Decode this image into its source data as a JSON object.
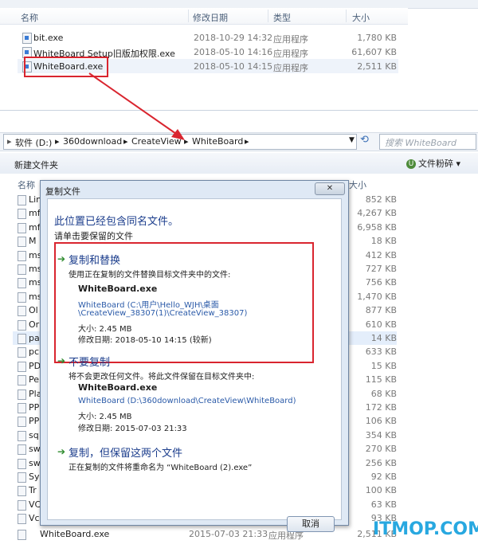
{
  "top_explorer": {
    "columns": {
      "name": "名称",
      "date": "修改日期",
      "type": "类型",
      "size": "大小"
    },
    "files": [
      {
        "name": "bit.exe",
        "date": "2018-10-29 14:32",
        "type": "应用程序",
        "size": "1,780 KB"
      },
      {
        "name": "WhiteBoard Setup旧版加权限.exe",
        "date": "2018-05-10 14:16",
        "type": "应用程序",
        "size": "61,607 KB"
      },
      {
        "name": "WhiteBoard.exe",
        "date": "2018-05-10 14:15",
        "type": "应用程序",
        "size": "2,511 KB"
      }
    ]
  },
  "address_bar": {
    "crumbs": [
      "软件 (D:)",
      "360download",
      "CreateView",
      "WhiteBoard"
    ],
    "search_placeholder": "搜索 WhiteBoard"
  },
  "toolbar": {
    "new_folder": "新建文件夹",
    "shredder": "文件粉碎"
  },
  "bg_list": {
    "header_name": "名称",
    "header_size": "大小",
    "rows": [
      {
        "name": "Lin",
        "size": "852 KB"
      },
      {
        "name": "mf",
        "size": "4,267 KB"
      },
      {
        "name": "mf",
        "size": "6,958 KB"
      },
      {
        "name": "M",
        "size": "18 KB"
      },
      {
        "name": "ms",
        "size": "412 KB"
      },
      {
        "name": "ms",
        "size": "727 KB"
      },
      {
        "name": "ms",
        "size": "756 KB"
      },
      {
        "name": "ms",
        "size": "1,470 KB"
      },
      {
        "name": "Ol",
        "size": "877 KB"
      },
      {
        "name": "Or",
        "size": "610 KB"
      },
      {
        "name": "pa",
        "size": "14 KB"
      },
      {
        "name": "pc",
        "size": "633 KB"
      },
      {
        "name": "PD",
        "size": "15 KB"
      },
      {
        "name": "Pe",
        "size": "115 KB"
      },
      {
        "name": "Pla",
        "size": "68 KB"
      },
      {
        "name": "PP",
        "size": "172 KB"
      },
      {
        "name": "PP",
        "size": "106 KB"
      },
      {
        "name": "sq",
        "size": "354 KB"
      },
      {
        "name": "sw",
        "size": "270 KB"
      },
      {
        "name": "sw",
        "size": "256 KB"
      },
      {
        "name": "Sy",
        "size": "92 KB"
      },
      {
        "name": "Tr",
        "size": "100 KB"
      },
      {
        "name": "VC",
        "size": "63 KB"
      },
      {
        "name": "Vc",
        "size": "93 KB"
      }
    ],
    "last_row": {
      "name": "WhiteBoard.exe",
      "date": "2015-07-03 21:33",
      "type": "应用程序",
      "size": "2,511 KB"
    }
  },
  "dialog": {
    "title": "复制文件",
    "heading": "此位置已经包含同名文件。",
    "subheading": "请单击要保留的文件",
    "replace": {
      "title": "复制和替换",
      "desc": "使用正在复制的文件替换目标文件夹中的文件:",
      "filename": "WhiteBoard.exe",
      "path1": "WhiteBoard (C:\\用户\\Hello_WJH\\桌面",
      "path2": "\\CreateView_38307(1)\\CreateView_38307)",
      "size": "大小: 2.45 MB",
      "date": "修改日期: 2018-05-10 14:15 (较新)"
    },
    "skip": {
      "title": "不要复制",
      "desc": "将不会更改任何文件。将此文件保留在目标文件夹中:",
      "filename": "WhiteBoard.exe",
      "path": "WhiteBoard (D:\\360download\\CreateView\\WhiteBoard)",
      "size": "大小: 2.45 MB",
      "date": "修改日期: 2015-07-03 21:33"
    },
    "keep_both": {
      "title": "复制，但保留这两个文件",
      "desc": "正在复制的文件将重命名为 “WhiteBoard (2).exe”"
    },
    "cancel": "取消",
    "close": "✕"
  },
  "watermark": "ITMOP.COM",
  "colors": {
    "annotation": "#d9252f",
    "link": "#2a5aa8",
    "heading": "#1b3d8c",
    "watermark": "#28a8e0"
  }
}
